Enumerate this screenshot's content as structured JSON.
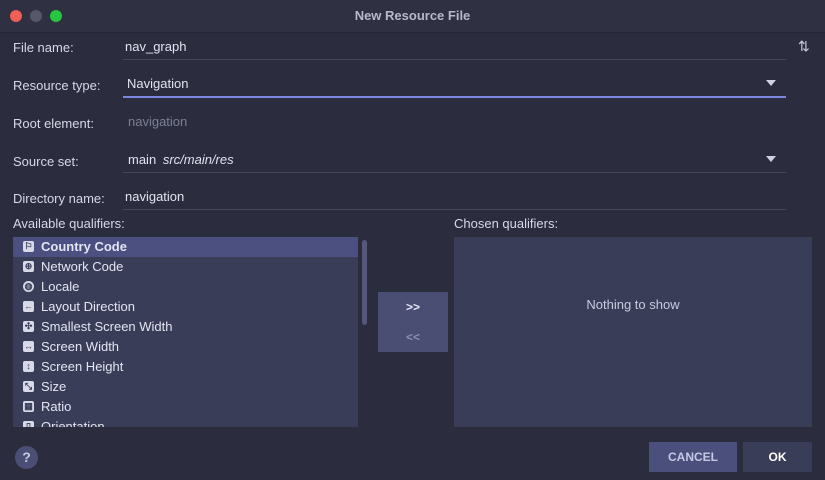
{
  "window": {
    "title": "New Resource File"
  },
  "form": {
    "file_name": {
      "label": "File name:",
      "value": "nav_graph"
    },
    "resource_type": {
      "label": "Resource type:",
      "value": "Navigation"
    },
    "root_element": {
      "label": "Root element:",
      "value": "navigation"
    },
    "source_set": {
      "label": "Source set:",
      "value": "main",
      "path": "src/main/res"
    },
    "directory_name": {
      "label": "Directory name:",
      "value": "navigation"
    }
  },
  "qualifiers": {
    "available_label": "Available qualifiers:",
    "chosen_label": "Chosen qualifiers:",
    "available": [
      {
        "label": "Country Code",
        "icon": "country-code-icon"
      },
      {
        "label": "Network Code",
        "icon": "network-code-icon"
      },
      {
        "label": "Locale",
        "icon": "globe-icon"
      },
      {
        "label": "Layout Direction",
        "icon": "layout-direction-icon"
      },
      {
        "label": "Smallest Screen Width",
        "icon": "smallest-width-icon"
      },
      {
        "label": "Screen Width",
        "icon": "screen-width-icon"
      },
      {
        "label": "Screen Height",
        "icon": "screen-height-icon"
      },
      {
        "label": "Size",
        "icon": "size-icon"
      },
      {
        "label": "Ratio",
        "icon": "ratio-icon"
      },
      {
        "label": "Orientation",
        "icon": "orientation-icon"
      }
    ],
    "selected": "Country Code",
    "add_label": ">>",
    "remove_label": "<<",
    "empty_text": "Nothing to show"
  },
  "footer": {
    "help": "?",
    "cancel_label": "CANCEL",
    "ok_label": "OK"
  }
}
